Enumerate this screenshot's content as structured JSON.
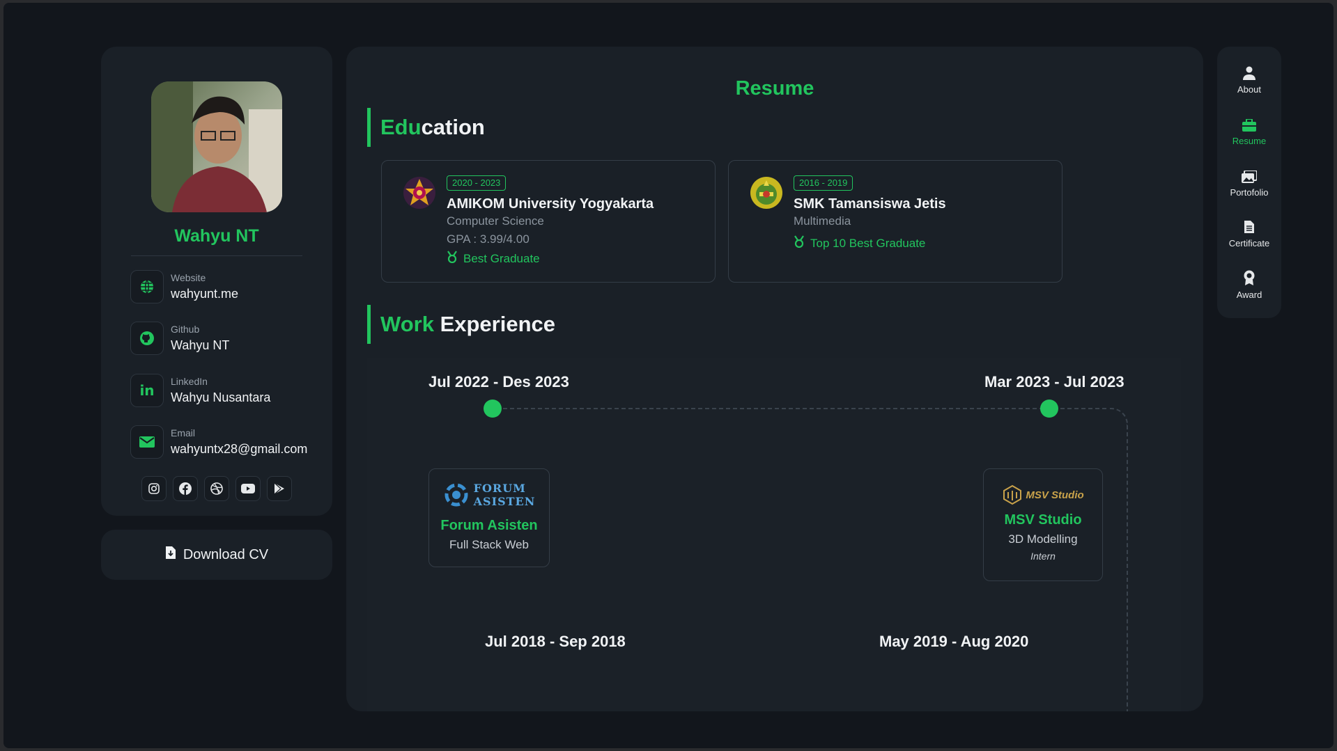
{
  "profile": {
    "name": "Wahyu NT",
    "contacts": [
      {
        "label": "Website",
        "value": "wahyunt.me",
        "icon": "globe-icon"
      },
      {
        "label": "Github",
        "value": "Wahyu NT",
        "icon": "github-icon"
      },
      {
        "label": "LinkedIn",
        "value": "Wahyu Nusantara",
        "icon": "linkedin-icon"
      },
      {
        "label": "Email",
        "value": "wahyuntx28@gmail.com",
        "icon": "envelope-icon"
      }
    ],
    "socials": [
      "instagram-icon",
      "facebook-icon",
      "dribbble-icon",
      "youtube-icon",
      "play-store-icon"
    ],
    "download_label": "Download CV"
  },
  "main": {
    "title": "Resume",
    "education_heading": {
      "green": "Edu",
      "white": "cation"
    },
    "education": [
      {
        "years": "2020 - 2023",
        "school": "AMIKOM University Yogyakarta",
        "major": "Computer Science",
        "gpa": "GPA : 3.99/4.00",
        "award": "Best Graduate"
      },
      {
        "years": "2016 - 2019",
        "school": "SMK Tamansiswa Jetis",
        "major": "Multimedia",
        "award": "Top 10 Best Graduate"
      }
    ],
    "work_heading": {
      "green": "Work",
      "white": " Experience"
    },
    "work_dates": {
      "top_left": "Jul 2022 - Des 2023",
      "top_right": "Mar 2023 - Jul 2023",
      "bottom_left": "Jul 2018 - Sep 2018",
      "bottom_right": "May 2019 - Aug 2020"
    },
    "work": [
      {
        "logo_line1": "FORUM",
        "logo_line2": "ASISTEN",
        "company": "Forum Asisten",
        "role": "Full Stack Web"
      },
      {
        "logo_text": "MSV Studio",
        "company": "MSV Studio",
        "role": "3D Modelling",
        "type": "Intern"
      }
    ]
  },
  "nav": {
    "items": [
      {
        "label": "About",
        "icon": "user-icon"
      },
      {
        "label": "Resume",
        "icon": "briefcase-icon",
        "active": true
      },
      {
        "label": "Portofolio",
        "icon": "images-icon"
      },
      {
        "label": "Certificate",
        "icon": "document-icon"
      },
      {
        "label": "Award",
        "icon": "award-icon"
      }
    ]
  },
  "colors": {
    "accent": "#22c55e",
    "background": "#12161c",
    "card": "#1a2027"
  }
}
